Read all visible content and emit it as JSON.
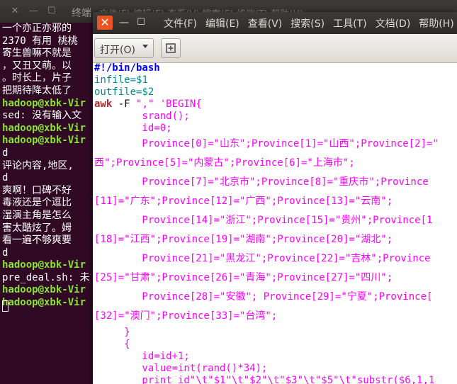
{
  "terminal": {
    "title": "终端",
    "menu": "文件(F)  编辑(E)  查看(V)  搜索(S)  终端(T)  帮助(H)",
    "lines": [
      {
        "text": "一个亦正亦邪的",
        "prompt": false
      },
      {
        "text": "2370 有用 桃桃",
        "prompt": false
      },
      {
        "text": "寄生兽嘛不就是",
        "prompt": false
      },
      {
        "text": "，又丑又萌。以",
        "prompt": false
      },
      {
        "text": "。时长上，片子",
        "prompt": false
      },
      {
        "text": "把期待降太低了",
        "prompt": false
      },
      {
        "text": "hadoop@xbk-Vir",
        "prompt": true
      },
      {
        "text": "sed: 没有输入文",
        "prompt": false
      },
      {
        "text": "hadoop@xbk-Vir",
        "prompt": true
      },
      {
        "text": "hadoop@xbk-Vir",
        "prompt": true
      },
      {
        "text": "d",
        "prompt": false
      },
      {
        "text": "评论内容,地区,",
        "prompt": false
      },
      {
        "text": "d",
        "prompt": false
      },
      {
        "text": "爽啊！口碑不好",
        "prompt": false
      },
      {
        "text": "毒液还是个逗比",
        "prompt": false
      },
      {
        "text": "湿演主角是怎么",
        "prompt": false
      },
      {
        "text": "害太酷炫了。姆",
        "prompt": false
      },
      {
        "text": "看一遍不够爽要",
        "prompt": false
      },
      {
        "text": "d",
        "prompt": false
      },
      {
        "text": "hadoop@xbk-Vir",
        "prompt": true
      },
      {
        "text": "pre_deal.sh: 未",
        "prompt": false
      },
      {
        "text": "hadoop@xbk-Vir",
        "prompt": true
      },
      {
        "text": "hadoop@xbk-Vir",
        "prompt": true
      }
    ]
  },
  "editor": {
    "menu": [
      "文件(F)",
      "编辑(E)",
      "查看(V)",
      "搜索(S)",
      "工具(T)",
      "文档(D)",
      "帮助(H)"
    ],
    "open_label": "打开(O)",
    "code_lines": [
      [
        {
          "t": "#!/bin/bash",
          "c": "com"
        }
      ],
      [
        {
          "t": "infile=",
          "c": "var"
        },
        {
          "t": "$1",
          "c": "var"
        }
      ],
      [
        {
          "t": "outfile=",
          "c": "var"
        },
        {
          "t": "$2",
          "c": "var"
        }
      ],
      [
        {
          "t": "awk",
          "c": "kw"
        },
        {
          "t": " -F ",
          "c": ""
        },
        {
          "t": "\",\"",
          "c": "str"
        },
        {
          "t": " ",
          "c": ""
        },
        {
          "t": "'BEGIN{",
          "c": "str"
        }
      ],
      [
        {
          "t": "        srand();",
          "c": "str"
        }
      ],
      [
        {
          "t": "        id=0;",
          "c": "str"
        }
      ],
      [
        {
          "t": "        Province[0]=\"山东\";Province[1]=\"山西\";Province[2]=\"",
          "c": "str"
        }
      ],
      [
        {
          "t": "西\";Province[5]=\"内蒙古\";Province[6]=\"上海市\";",
          "c": "str"
        }
      ],
      [
        {
          "t": "        Province[7]=\"北京市\";Province[8]=\"重庆市\";Province",
          "c": "str"
        }
      ],
      [
        {
          "t": "[11]=\"广东\";Province[12]=\"广西\";Province[13]=\"云南\";",
          "c": "str"
        }
      ],
      [
        {
          "t": "        Province[14]=\"浙江\";Province[15]=\"贵州\";Province[1",
          "c": "str"
        }
      ],
      [
        {
          "t": "[18]=\"江西\";Province[19]=\"湖南\";Province[20]=\"湖北\";",
          "c": "str"
        }
      ],
      [
        {
          "t": "        Province[21]=\"黑龙江\";Province[22]=\"吉林\";Province",
          "c": "str"
        }
      ],
      [
        {
          "t": "[25]=\"甘肃\";Province[26]=\"青海\";Province[27]=\"四川\";",
          "c": "str"
        }
      ],
      [
        {
          "t": "        Province[28]=\"安徽\"; Province[29]=\"宁夏\";Province[",
          "c": "str"
        }
      ],
      [
        {
          "t": "[32]=\"澳门\";Province[33]=\"台湾\";",
          "c": "str"
        }
      ],
      [
        {
          "t": "     }",
          "c": "str"
        }
      ],
      [
        {
          "t": "     {",
          "c": "str"
        }
      ],
      [
        {
          "t": "        id=id+1;",
          "c": "str"
        }
      ],
      [
        {
          "t": "        value=int(rand()*34);",
          "c": "str"
        }
      ],
      [
        {
          "t": "        print id\"\\t\"$1\"\\t\"$2\"\\t\"$3\"\\t\"$5\"\\t\"substr($6,1,1",
          "c": "str"
        }
      ]
    ]
  }
}
